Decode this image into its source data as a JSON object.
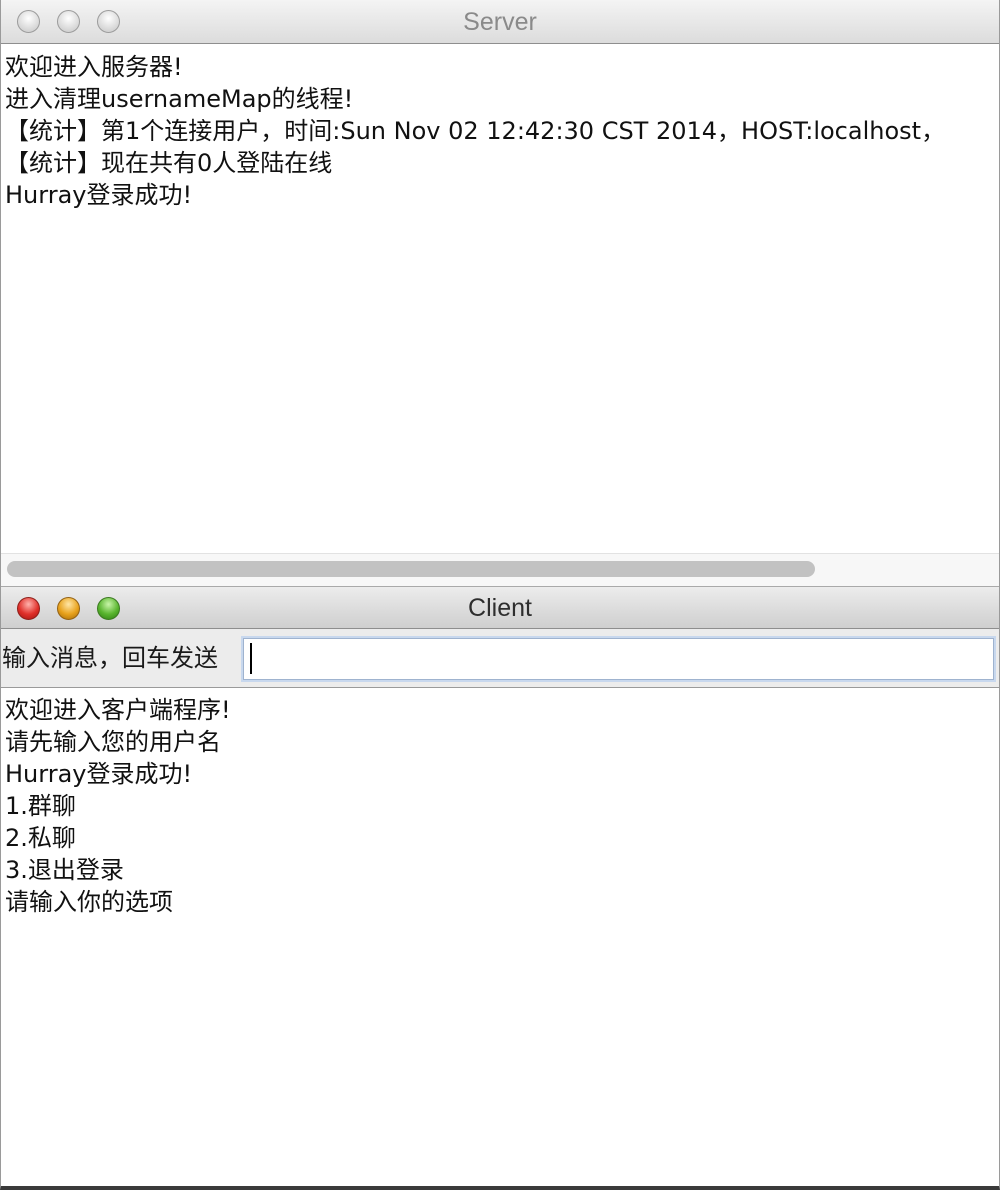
{
  "server": {
    "title": "Server",
    "log": [
      "欢迎进入服务器!",
      "进入清理usernameMap的线程!",
      "【统计】第1个连接用户，时间:Sun Nov 02 12:42:30 CST 2014，HOST:localhost，",
      "【统计】现在共有0人登陆在线",
      "Hurray登录成功!"
    ]
  },
  "client": {
    "title": "Client",
    "input_label": "输入消息，回车发送",
    "input_value": "",
    "log": [
      "欢迎进入客户端程序!",
      "请先输入您的用户名",
      "Hurray登录成功!",
      "1.群聊",
      "2.私聊",
      "3.退出登录",
      "请输入你的选项"
    ]
  }
}
